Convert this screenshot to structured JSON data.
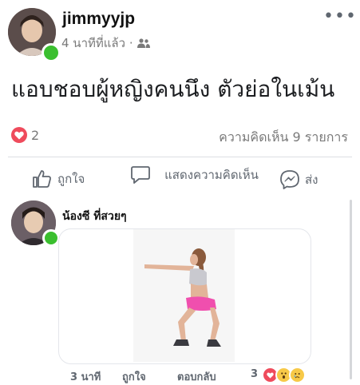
{
  "post": {
    "author": "jimmyyjp",
    "time": "4 นาทีที่แล้ว ·",
    "text": "แอบชอบผู้หญิงคนนึง ตัวย่อในเม้น",
    "reactions_count": "2",
    "comments_count": "ความคิดเห็น 9 รายการ"
  },
  "actions": {
    "like": "ถูกใจ",
    "comment": "แสดงความคิดเห็น",
    "share": "ส่ง"
  },
  "comment": {
    "author": "น้องซี ที่สวยๆ",
    "time": "3 นาที",
    "like": "ถูกใจ",
    "reply": "ตอบกลับ",
    "reactions_count": "3"
  },
  "icons": {
    "more": "more-dots-icon",
    "audience": "friends-icon",
    "like": "thumbs-up-icon",
    "comment": "speech-bubble-icon",
    "share": "messenger-icon",
    "reaction": "heart-icon"
  },
  "colors": {
    "online": "#3bbf2f",
    "heart": "#ef4b5c",
    "muted_text": "#7a7a7a"
  }
}
